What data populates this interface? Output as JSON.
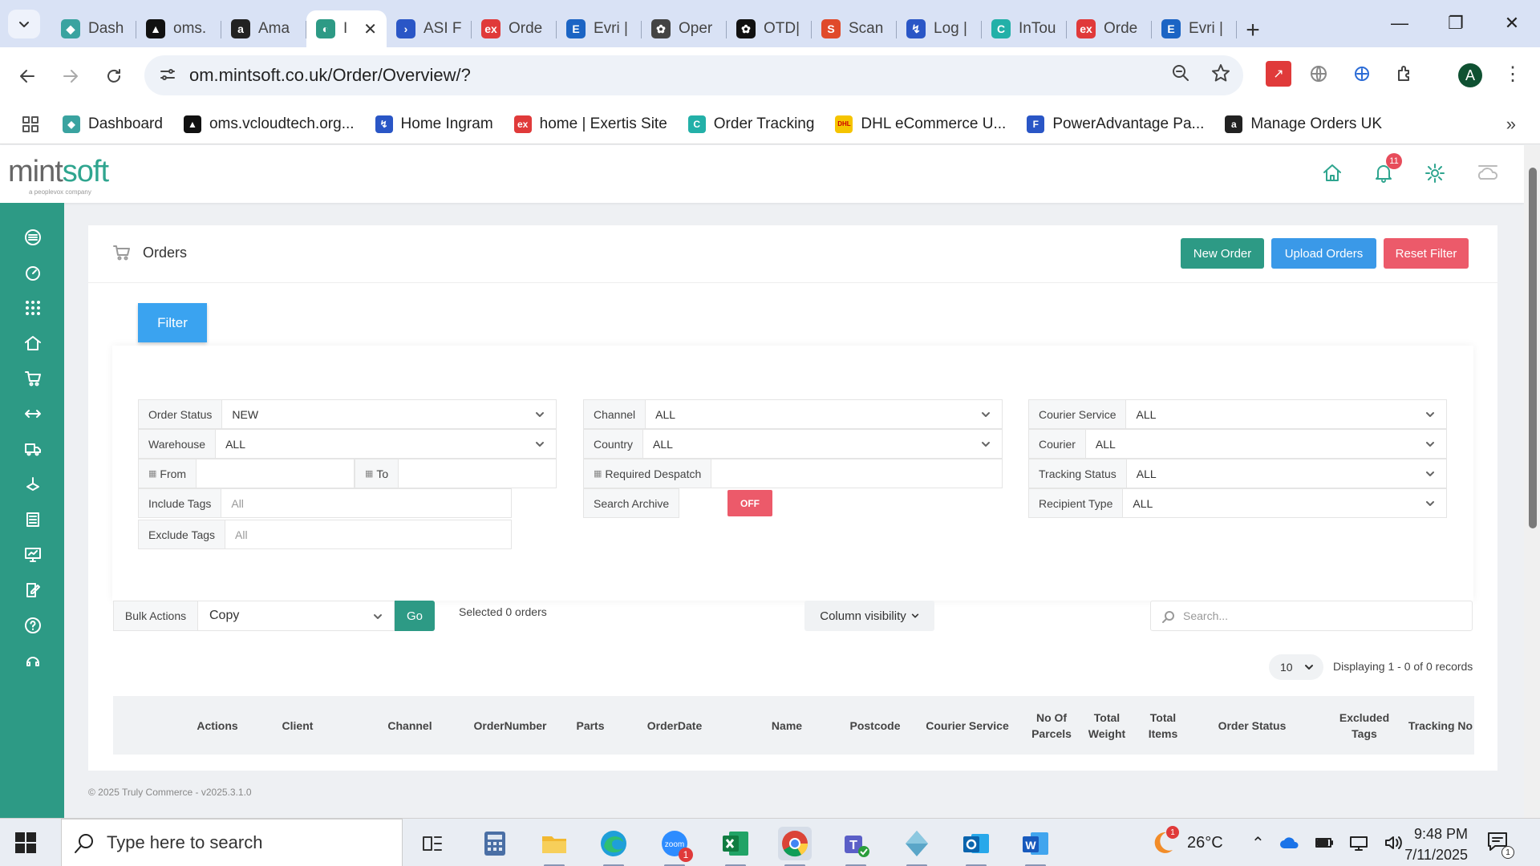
{
  "browser": {
    "tabs": [
      {
        "label": "Dash",
        "fav_color": "#3aa3a0",
        "fav_char": "◆"
      },
      {
        "label": "oms.",
        "fav_color": "#111111",
        "fav_char": "▲"
      },
      {
        "label": "Ama",
        "fav_color": "#222222",
        "fav_char": "a"
      },
      {
        "label": "I",
        "fav_color": "#2d9a85",
        "fav_char": "◐",
        "active": true
      },
      {
        "label": "ASI F",
        "fav_color": "#2a56c6",
        "fav_char": "›"
      },
      {
        "label": "Orde",
        "fav_color": "#e03a3a",
        "fav_char": "ex"
      },
      {
        "label": "Evri |",
        "fav_color": "#1b64c4",
        "fav_char": "E"
      },
      {
        "label": "Oper",
        "fav_color": "#444444",
        "fav_char": "✿"
      },
      {
        "label": "OTD|",
        "fav_color": "#111111",
        "fav_char": "✿"
      },
      {
        "label": "Scan",
        "fav_color": "#e04a2a",
        "fav_char": "S"
      },
      {
        "label": "Log |",
        "fav_color": "#2a56c6",
        "fav_char": "↯"
      },
      {
        "label": "InTou",
        "fav_color": "#23b0a8",
        "fav_char": "C"
      },
      {
        "label": "Orde",
        "fav_color": "#e03a3a",
        "fav_char": "ex"
      },
      {
        "label": "Evri |",
        "fav_color": "#1b64c4",
        "fav_char": "E"
      }
    ],
    "url": "om.mintsoft.co.uk/Order/Overview/?",
    "bookmarks": [
      {
        "label": "Dashboard",
        "fav_color": "#3aa3a0",
        "fav_char": "◆"
      },
      {
        "label": "oms.vcloudtech.org...",
        "fav_color": "#111111",
        "fav_char": "▲"
      },
      {
        "label": "Home Ingram",
        "fav_color": "#2a56c6",
        "fav_char": "↯"
      },
      {
        "label": "home | Exertis Site",
        "fav_color": "#e03a3a",
        "fav_char": "ex"
      },
      {
        "label": "Order Tracking",
        "fav_color": "#23b0a8",
        "fav_char": "C"
      },
      {
        "label": "DHL eCommerce U...",
        "fav_color": "#f5c400",
        "fav_char": "DHL"
      },
      {
        "label": "PowerAdvantage Pa...",
        "fav_color": "#2a56c6",
        "fav_char": "F"
      },
      {
        "label": "Manage Orders UK",
        "fav_color": "#222222",
        "fav_char": "a"
      }
    ],
    "profile_initial": "A"
  },
  "app": {
    "logo_main": "mint",
    "logo_accent": "soft",
    "logo_tag": "a peoplevox company",
    "notification_count": "11",
    "page_title": "Orders",
    "buttons": {
      "new_order": "New Order",
      "upload_orders": "Upload Orders",
      "reset_filter": "Reset Filter",
      "filter": "Filter"
    },
    "filters": {
      "order_status": {
        "label": "Order Status",
        "value": "NEW"
      },
      "warehouse": {
        "label": "Warehouse",
        "value": "ALL"
      },
      "from": {
        "label": "From",
        "value": ""
      },
      "to": {
        "label": "To",
        "value": ""
      },
      "include_tags": {
        "label": "Include Tags",
        "placeholder": "All"
      },
      "exclude_tags": {
        "label": "Exclude Tags",
        "placeholder": "All"
      },
      "channel": {
        "label": "Channel",
        "value": "ALL"
      },
      "country": {
        "label": "Country",
        "value": "ALL"
      },
      "required_despatch": {
        "label": "Required Despatch",
        "value": ""
      },
      "search_archive": {
        "label": "Search Archive",
        "value": "OFF"
      },
      "courier_service": {
        "label": "Courier Service",
        "value": "ALL"
      },
      "courier": {
        "label": "Courier",
        "value": "ALL"
      },
      "tracking_status": {
        "label": "Tracking Status",
        "value": "ALL"
      },
      "recipient_type": {
        "label": "Recipient Type",
        "value": "ALL"
      }
    },
    "bulk": {
      "label": "Bulk Actions",
      "value": "Copy",
      "go": "Go"
    },
    "selected_text": "Selected 0 orders",
    "column_visibility": "Column visibility",
    "search_placeholder": "Search...",
    "page_size": "10",
    "displaying": "Displaying 1 - 0 of 0 records",
    "columns": [
      "Actions",
      "Client",
      "Channel",
      "OrderNumber",
      "Parts",
      "OrderDate",
      "Name",
      "Postcode",
      "Courier Service",
      "No Of Parcels",
      "Total Weight",
      "Total Items",
      "Order Status",
      "Excluded Tags",
      "Tracking No"
    ],
    "footer": "© 2025 Truly Commerce - v2025.3.1.0"
  },
  "taskbar": {
    "search_placeholder": "Type here to search",
    "temperature": "26°C",
    "time": "9:48 PM",
    "date": "7/11/2025",
    "zoom_badge": "1",
    "weather_badge": "1",
    "notifications_badge": "1"
  },
  "colors": {
    "brand": "#2d9a85",
    "primary": "#3a99e8",
    "danger": "#ec5a6a"
  }
}
